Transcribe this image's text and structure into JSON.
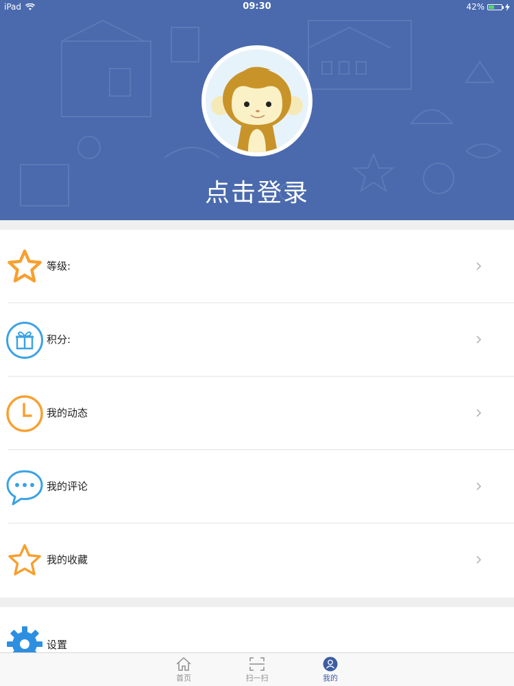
{
  "status_bar": {
    "device": "iPad",
    "time": "09:30",
    "battery": "42%",
    "battery_level": 0.42
  },
  "profile": {
    "login_label": "点击登录"
  },
  "menu": {
    "items": [
      {
        "label": "等级:",
        "icon": "star-icon"
      },
      {
        "label": "积分:",
        "icon": "gift-icon"
      },
      {
        "label": "我的动态",
        "icon": "clock-icon"
      },
      {
        "label": "我的评论",
        "icon": "chat-bubble-icon"
      },
      {
        "label": "我的收藏",
        "icon": "star-outline-icon"
      }
    ]
  },
  "settings": {
    "label": "设置",
    "icon": "gear-icon"
  },
  "tabbar": {
    "tabs": [
      {
        "label": "首页",
        "icon": "home-icon"
      },
      {
        "label": "扫一扫",
        "icon": "scan-icon"
      },
      {
        "label": "我的",
        "icon": "user-icon",
        "active": true
      }
    ]
  },
  "colors": {
    "header_bg": "#4a6aad",
    "orange": "#f7a030",
    "blue": "#3ba2e4",
    "active_tab": "#3c5ca3"
  }
}
